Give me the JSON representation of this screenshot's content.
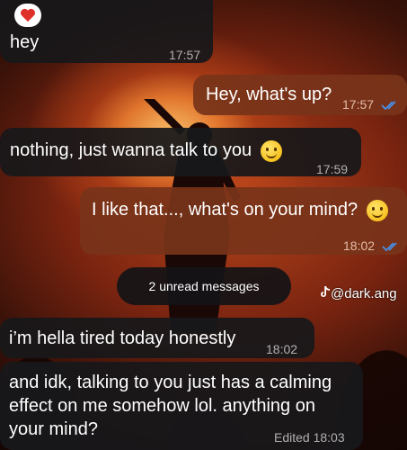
{
  "messages": [
    {
      "text": "hey",
      "time": "17:57"
    },
    {
      "text": "Hey, what's up?",
      "time": "17:57"
    },
    {
      "text": "nothing, just wanna talk to you",
      "time": "17:59"
    },
    {
      "text": "I like that..., what's on your mind?",
      "time": "18:02"
    },
    {
      "text": "i’m hella tired today honestly",
      "time": "18:02"
    },
    {
      "text": "and idk, talking to you just has a calming effect on me somehow lol. anything on your mind?",
      "time": "Edited 18:03"
    }
  ],
  "unread_label": "2 unread messages",
  "watermark": "@dark.ang",
  "colors": {
    "read_checks": "#4a8fe8",
    "incoming_bubble": "#18181a",
    "outgoing_bubble": "#78341a"
  }
}
